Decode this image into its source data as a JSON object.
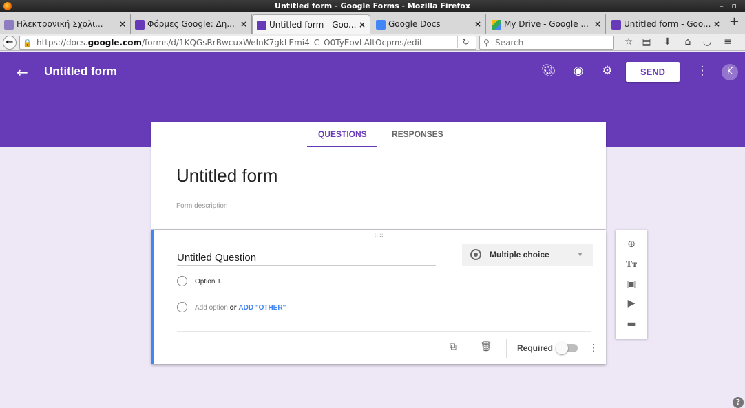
{
  "window": {
    "title": "Untitled form - Google Forms - Mozilla Firefox"
  },
  "tabs": [
    {
      "label": "Ηλεκτρονική Σχολι...",
      "icon": "browser-tab-icon"
    },
    {
      "label": "Φόρμες Google: Δη...",
      "icon": "forms-icon"
    },
    {
      "label": "Untitled form - Goo...",
      "icon": "forms-icon"
    },
    {
      "label": "Google Docs",
      "icon": "docs-icon"
    },
    {
      "label": "My Drive - Google ...",
      "icon": "drive-icon"
    },
    {
      "label": "Untitled form - Goo...",
      "icon": "forms-icon"
    }
  ],
  "nav": {
    "url_prefix": "https://docs.",
    "url_domain": "google.com",
    "url_rest": "/forms/d/1KQGsRrBwcuxWeInK7gkLEmi4_C_O0TyEovLAltOcpms/edit",
    "search_placeholder": "Search"
  },
  "header": {
    "title": "Untitled form",
    "send_label": "SEND",
    "avatar_initial": "K",
    "accent": "#673ab7"
  },
  "form_tabs": {
    "questions": "QUESTIONS",
    "responses": "RESPONSES"
  },
  "form": {
    "title": "Untitled form",
    "description_placeholder": "Form description"
  },
  "question": {
    "title": "Untitled Question",
    "type": "Multiple choice",
    "option1": "Option 1",
    "add_option": "Add option",
    "or": "or",
    "add_other": "ADD \"OTHER\"",
    "required_label": "Required",
    "required": false
  }
}
